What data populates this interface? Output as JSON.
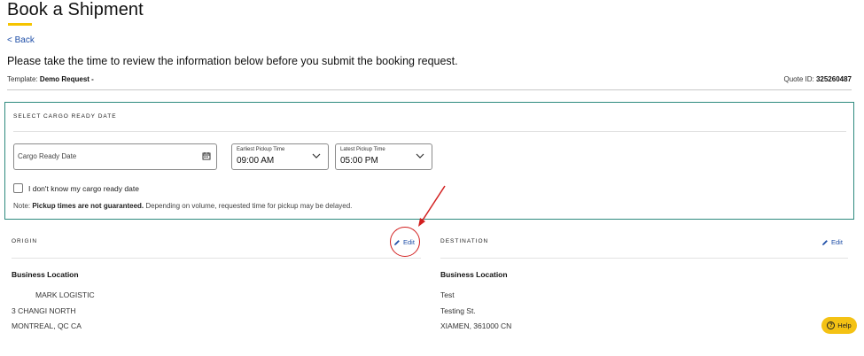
{
  "header": {
    "title": "Book a Shipment",
    "back_label": "< Back"
  },
  "intro_text": "Please take the time to review the information below before you submit the booking request.",
  "meta": {
    "template_label": "Template:",
    "template_value": "Demo Request -",
    "quote_label": "Quote ID:",
    "quote_value": "325260487"
  },
  "cargo": {
    "heading": "SELECT CARGO READY DATE",
    "date_placeholder": "Cargo Ready Date",
    "earliest_label": "Earliest Pickup Time",
    "earliest_value": "09:00 AM",
    "latest_label": "Latest Pickup Time",
    "latest_value": "05:00 PM",
    "unknown_date_label": "I don't know my cargo ready date",
    "note_prefix": "Note: ",
    "note_bold": "Pickup times are not guaranteed.",
    "note_rest": " Depending on volume, requested time for pickup may be delayed."
  },
  "origin": {
    "heading": "ORIGIN",
    "edit_label": "Edit",
    "sub_heading": "Business Location",
    "line1": "MARK LOGISTIC",
    "line2": "3 CHANGI NORTH",
    "line3": "MONTREAL, QC CA"
  },
  "destination": {
    "heading": "DESTINATION",
    "edit_label": "Edit",
    "sub_heading": "Business Location",
    "line1": "Test",
    "line2": "Testing St.",
    "line3": "XIAMEN, 361000 CN"
  },
  "help": {
    "label": "Help"
  },
  "colors": {
    "accent_yellow": "#f5c400",
    "teal_border": "#2e8a7e",
    "link_blue": "#1f4fa8",
    "annotation_red": "#d21f1f"
  },
  "icons": {
    "back": "chevron-left-icon",
    "calendar": "calendar-icon",
    "dropdown": "chevron-down-icon",
    "edit": "pencil-icon",
    "help": "question-circle-icon"
  }
}
